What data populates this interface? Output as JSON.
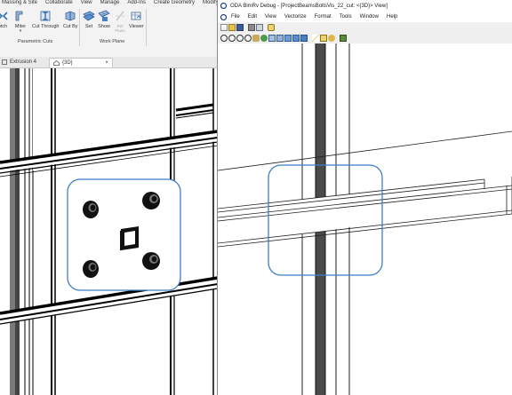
{
  "revit": {
    "menu_tabs": [
      "Massing & Site",
      "Collaborate",
      "View",
      "Manage",
      "Add-Ins",
      "Create Geometry",
      "Modify"
    ],
    "tools": {
      "notch": "otch",
      "miter": "Miter",
      "cut_through": "Cut Through",
      "cut_by": "Cut By",
      "set": "Set",
      "show": "Show",
      "ref_plane": "Ref Plane",
      "viewer": "Viewer"
    },
    "groups": {
      "parametric_cuts": "Parametric Cuts",
      "work_plane": "Work Plane"
    },
    "view_tabs": [
      "Extrusion 4",
      "{3D}"
    ],
    "tab_close": "×",
    "colors": {
      "steel": "#000000",
      "highlight": "#3b7fc8",
      "wall_shadow": "#5b5b5b"
    }
  },
  "oda": {
    "title": "ODA BimRv Debug - [ProjectBeamsBoltsVis_22_cut: <{3D}> View]",
    "menu": [
      "File",
      "Edit",
      "View",
      "Vectorize",
      "Format",
      "Tools",
      "Window",
      "Help"
    ],
    "toolbar1_icons": [
      "new-icon",
      "open-icon",
      "save-icon",
      "print-icon",
      "print-preview-icon",
      "help-icon"
    ],
    "toolbar2_icons": [
      "zoom-window-icon",
      "zoom-in-icon",
      "zoom-out-icon",
      "zoom-extents-icon",
      "pan-icon",
      "orbit-icon",
      "wireframe-icon",
      "hidden-icon",
      "flat-shaded-icon",
      "gouraud-icon",
      "shaded-edges-icon",
      "light-icon",
      "background-icon",
      "view-settings-icon",
      "grid-icon"
    ]
  }
}
